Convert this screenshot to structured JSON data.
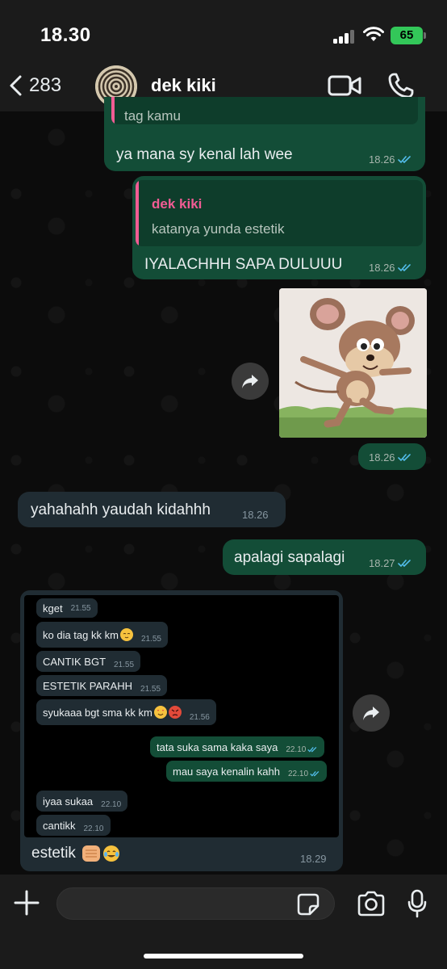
{
  "status_bar": {
    "time": "18.30",
    "battery": "65"
  },
  "header": {
    "back_count": "283",
    "contact_name": "dek kiki"
  },
  "messages": [
    {
      "direction": "outgoing",
      "quote_text": "tag kamu",
      "text": "ya mana sy kenal lah wee",
      "time": "18.26",
      "status": "read"
    },
    {
      "direction": "outgoing",
      "quote_name": "dek kiki",
      "quote_text": "katanya yunda estetik",
      "text": "IYALACHHH SAPA DULUUU",
      "time": "18.26",
      "status": "read"
    },
    {
      "direction": "outgoing",
      "type": "image",
      "time": "18.26",
      "status": "read"
    },
    {
      "direction": "incoming",
      "text": "yahahahh yaudah kidahhh",
      "time": "18.26"
    },
    {
      "direction": "outgoing",
      "text": "apalagi sapalagi",
      "time": "18.27",
      "status": "read"
    },
    {
      "direction": "incoming",
      "type": "image_with_caption",
      "caption": "estetik",
      "time": "18.29"
    }
  ],
  "screenshot_messages": [
    {
      "direction": "incoming",
      "text": "kget",
      "time": "21.55"
    },
    {
      "direction": "incoming",
      "text": "ko dia tag kk km",
      "time": "21.55"
    },
    {
      "direction": "incoming",
      "text": "CANTIK BGT",
      "time": "21.55"
    },
    {
      "direction": "incoming",
      "text": "ESTETIK PARAHH",
      "time": "21.55"
    },
    {
      "direction": "incoming",
      "text": "syukaaa bgt sma kk km",
      "time": "21.56"
    },
    {
      "direction": "outgoing",
      "text": "tata suka sama kaka saya",
      "time": "22.10"
    },
    {
      "direction": "outgoing",
      "text": "mau saya kenalin kahh",
      "time": "22.10"
    },
    {
      "direction": "incoming",
      "text": "iyaa sukaa",
      "time": "22.10"
    },
    {
      "direction": "incoming",
      "text": "cantikk",
      "time": "22.10"
    }
  ],
  "icons": {
    "back": "chevron-left-icon",
    "video": "video-camera-icon",
    "call": "phone-icon",
    "forward": "forward-arrow-icon",
    "plus": "plus-icon",
    "sticker": "sticker-icon",
    "camera": "camera-icon",
    "mic": "microphone-icon"
  },
  "colors": {
    "outgoing_bubble": "#134d37",
    "incoming_bubble": "#202c33",
    "quote_accent": "#f15c94",
    "read_ticks": "#53bdeb",
    "battery": "#33c759"
  }
}
